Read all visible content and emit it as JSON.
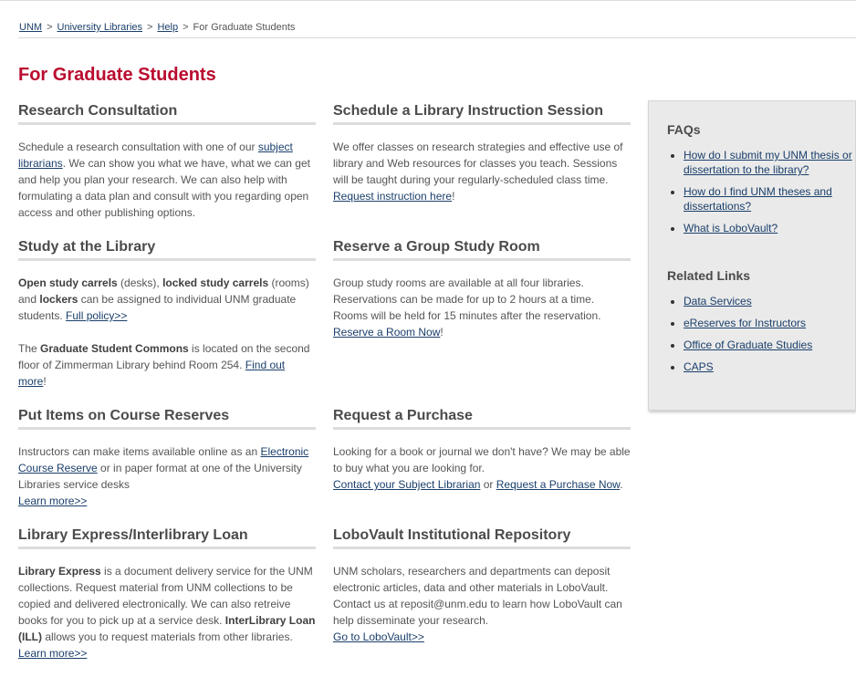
{
  "breadcrumb": {
    "items": [
      "UNM",
      "University Libraries",
      "Help"
    ],
    "current": "For Graduate Students",
    "separator": ">"
  },
  "page": {
    "title": "For Graduate Students"
  },
  "sections": {
    "research": {
      "title": "Research Consultation",
      "t1": "Schedule a research consultation with one of our ",
      "link1": "subject librarians",
      "t2": ".  We can show you what we have, what we can get and help you plan your research. We can also help with formulating a data plan and consult with you regarding open access and other publishing options."
    },
    "instruction": {
      "title": "Schedule a Library Instruction Session",
      "t1": "We offer classes on research strategies and effective use of library and Web resources for classes you teach. Sessions will be taught during your regularly-scheduled class time.",
      "link1": "Request instruction here",
      "t2": "!"
    },
    "study": {
      "title": "Study at the Library",
      "b1": "Open study carrels",
      "t1": " (desks), ",
      "b2": "locked study carrels",
      "t2": " (rooms) and ",
      "b3": "lockers",
      "t3": " can be assigned to individual UNM graduate students. ",
      "link1": "Full policy>>",
      "t4": "The ",
      "b4": "Graduate Student Commons",
      "t5": " is located on the second floor of Zimmerman Library behind Room 254. ",
      "link2": "Find out more",
      "t6": "!"
    },
    "group_room": {
      "title": "Reserve a Group Study Room",
      "t1": "Group study rooms are available at all four libraries. Reservations can be made for up to 2 hours at a time. Rooms will be held for 15 minutes after the reservation.",
      "link1": "Reserve a Room Now",
      "t2": "!"
    },
    "reserves": {
      "title": "Put Items on Course Reserves",
      "t1": "Instructors can make items available online as an ",
      "link1": "Electronic Course Reserve",
      "t2": " or in paper format at one of the University Libraries service desks",
      "link2": "Learn more>>"
    },
    "purchase": {
      "title": "Request a Purchase",
      "t1": "Looking for a book or journal we don't have? We may be able to buy what you are looking for.",
      "link1": "Contact your Subject Librarian",
      "t2": " or ",
      "link2": "Request a Purchase Now",
      "t3": "."
    },
    "express": {
      "title": "Library Express/Interlibrary Loan",
      "b1": "Library Express",
      "t1": " is a document delivery service for the UNM collections. Request material from UNM collections to be copied and delivered electronically. We can also retreive books for you to pick up at a service desk. ",
      "b2": "InterLibrary Loan (ILL)",
      "t2": " allows you to request materials from other libraries.",
      "link1": "Learn more>>"
    },
    "lobovault": {
      "title": "LoboVault Institutional Repository",
      "t1": "UNM scholars, researchers and departments can deposit electronic articles, data and other materials in LoboVault. Contact us at reposit@unm.edu to learn how LoboVault can help disseminate your research.",
      "link1": "Go to LoboVault>>"
    }
  },
  "sidebar": {
    "faqs_title": "FAQs",
    "faqs": [
      "How do I submit my UNM thesis or dissertation to the library?",
      "How do I find UNM theses and dissertations?",
      "What is LoboVault?"
    ],
    "related_title": "Related Links",
    "related": [
      "Data Services",
      "eReserves for Instructors",
      "Office of Graduate Studies",
      "CAPS"
    ]
  },
  "colors": {
    "title": "#ba0c2f",
    "link": "#1a3f6b",
    "sidebar_bg": "#eaeaea"
  }
}
